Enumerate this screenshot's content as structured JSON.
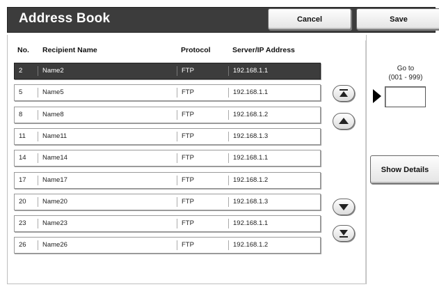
{
  "header": {
    "title": "Address Book",
    "cancel_label": "Cancel",
    "save_label": "Save"
  },
  "table": {
    "columns": [
      "No.",
      "Recipient Name",
      "Protocol",
      "Server/IP Address"
    ],
    "rows": [
      {
        "no": "2",
        "name": "Name2",
        "protocol": "FTP",
        "server": "192.168.1.1",
        "selected": true
      },
      {
        "no": "5",
        "name": "Name5",
        "protocol": "FTP",
        "server": "192.168.1.1"
      },
      {
        "no": "8",
        "name": "Name8",
        "protocol": "FTP",
        "server": "192.168.1.2"
      },
      {
        "no": "11",
        "name": "Name11",
        "protocol": "FTP",
        "server": "192.168.1.3"
      },
      {
        "no": "14",
        "name": "Name14",
        "protocol": "FTP",
        "server": "192.168.1.1"
      },
      {
        "no": "17",
        "name": "Name17",
        "protocol": "FTP",
        "server": "192.168.1.2"
      },
      {
        "no": "20",
        "name": "Name20",
        "protocol": "FTP",
        "server": "192.168.1.3"
      },
      {
        "no": "23",
        "name": "Name23",
        "protocol": "FTP",
        "server": "192.168.1.1"
      },
      {
        "no": "26",
        "name": "Name26",
        "protocol": "FTP",
        "server": "192.168.1.2"
      }
    ]
  },
  "scroll": {
    "top_icon": "scroll-to-top-icon",
    "up_icon": "scroll-up-icon",
    "down_icon": "scroll-down-icon",
    "bottom_icon": "scroll-to-bottom-icon"
  },
  "goto": {
    "label": "Go to",
    "range": "(001 - 999)",
    "value": ""
  },
  "details": {
    "label": "Show Details"
  },
  "colors": {
    "title_bar": "#3c3c3c",
    "selected_row": "#3c3c3c"
  }
}
